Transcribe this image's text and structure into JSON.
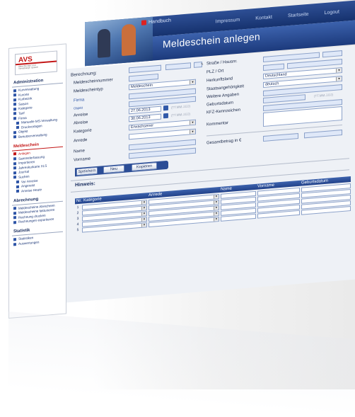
{
  "topnav": {
    "items": [
      "Impressum",
      "Kontakt",
      "Startseite",
      "Logout"
    ]
  },
  "banner": {
    "handbuch": "Handbuch",
    "title": "Meldeschein anlegen"
  },
  "logo": {
    "name": "AVS",
    "subtitle": "Abrechnungs- und Verwaltungs- System"
  },
  "sidebar": {
    "sections": [
      {
        "title": "Administration",
        "active": false,
        "items": [
          {
            "label": "Kurverwaltung"
          },
          {
            "label": "Kurorte"
          },
          {
            "label": "Kurbezirk"
          },
          {
            "label": "Saison"
          },
          {
            "label": "Kategorie"
          },
          {
            "label": "Tarif"
          },
          {
            "label": "Firma"
          },
          {
            "label": "Manuelle MS-Verwaltung",
            "sub": true
          },
          {
            "label": "Druckvorlagen",
            "sub": true
          },
          {
            "label": "Objekt"
          },
          {
            "label": "Benutzerverwaltung"
          }
        ]
      },
      {
        "title": "Meldeschein",
        "active": true,
        "items": [
          {
            "label": "Anlegen",
            "active": true
          },
          {
            "label": "Sammelerfassung"
          },
          {
            "label": "Importieren"
          },
          {
            "label": "Jahreskurkarte XLS"
          },
          {
            "label": "Journal"
          },
          {
            "label": "Suchen"
          },
          {
            "label": "Vor Anreise",
            "sub": true
          },
          {
            "label": "Angereist",
            "sub": true
          },
          {
            "label": "Anreise Heute",
            "sub": true
          }
        ]
      },
      {
        "title": "Abrechnung",
        "active": false,
        "items": [
          {
            "label": "Meldescheine Abrechnen"
          },
          {
            "label": "Meldescheine fakturieren"
          },
          {
            "label": "Rechnung drucken"
          },
          {
            "label": "Rechnungen exportieren"
          }
        ]
      },
      {
        "title": "Statistik",
        "active": false,
        "items": [
          {
            "label": "Statistiken"
          },
          {
            "label": "Auswertungen"
          }
        ]
      }
    ]
  },
  "form": {
    "berechnung": "Berechnung:",
    "meldescheinnummer_label": "Meldescheinnummer",
    "meldescheintyp_label": "Meldescheintyp",
    "meldescheintyp_value": "Meldeschein",
    "firma_label": "Firma",
    "objekt_label": "Objekt",
    "anreise_label": "Anreise",
    "anreise_value": "27.06.2013",
    "abreise_label": "Abreise",
    "abreise_value": "30.06.2013",
    "date_hint": "(TT.MM.JJJJ)",
    "kategorie_label": "Kategorie",
    "kategorie_value": "Erwachsener",
    "anrede_label": "Anrede",
    "name_label": "Name",
    "vorname_label": "Vorname",
    "strasse_label": "Straße / Hausnr.",
    "plz_label": "PLZ / Ort",
    "herkunftsland_label": "Herkunftsland",
    "herkunftsland_value": "Deutschland",
    "staatsangehoerigkeit_label": "Staatsangehörigkeit",
    "staatsangehoerigkeit_value": "deutsch",
    "weitere_label": "Weitere Angaben",
    "geburtsdatum_label": "Geburtsdatum",
    "geburtsdatum_hint": "(TT.MM.JJJJ)",
    "kfz_label": "KFZ-Kennzeichen",
    "kommentar_label": "Kommentar",
    "gesamtbetrag_label": "Gesamtbetrag in €"
  },
  "buttons": {
    "speichern": "Speichern",
    "neu": "Neu",
    "kopieren": "Kopieren"
  },
  "hinweis": "Hinweis:",
  "table": {
    "headers": [
      "Nr.",
      "Kategorie",
      "Anrede",
      "Name",
      "Vorname",
      "Geburtsdatum"
    ],
    "rows": [
      "1",
      "2",
      "3",
      "4",
      "5"
    ]
  }
}
